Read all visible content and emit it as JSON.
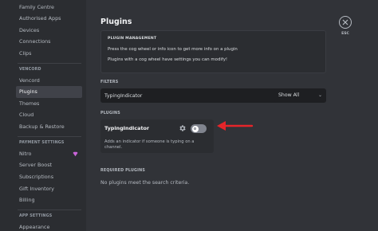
{
  "sidebar": {
    "items_top": [
      {
        "label": "Family Centre"
      },
      {
        "label": "Authorised Apps"
      },
      {
        "label": "Devices"
      },
      {
        "label": "Connections"
      },
      {
        "label": "Clips"
      }
    ],
    "vencord_header": "VENCORD",
    "vencord_items": [
      {
        "label": "Vencord"
      },
      {
        "label": "Plugins",
        "active": true
      },
      {
        "label": "Themes"
      },
      {
        "label": "Cloud"
      },
      {
        "label": "Backup & Restore"
      }
    ],
    "payment_header": "PAYMENT SETTINGS",
    "payment_items": [
      {
        "label": "Nitro"
      },
      {
        "label": "Server Boost"
      },
      {
        "label": "Subscriptions"
      },
      {
        "label": "Gift Inventory"
      },
      {
        "label": "Billing"
      }
    ],
    "app_header": "APP SETTINGS",
    "app_items": [
      {
        "label": "Appearance"
      }
    ],
    "nitro_icon": "nitro-badge-icon",
    "nitro_icon_color": "#c964d8"
  },
  "main": {
    "title": "Plugins",
    "info": {
      "title": "PLUGIN MANAGEMENT",
      "line1": "Press the cog wheel or info icon to get more info on a plugin",
      "line2": "Plugins with a cog wheel have settings you can modify!"
    },
    "filters": {
      "label": "FILTERS",
      "search_value": "TypingIndicator",
      "select_value": "Show All"
    },
    "plugins": {
      "label": "PLUGINS",
      "card": {
        "name": "TypingIndicator",
        "description": "Adds an indicator if someone is typing on a channel.",
        "enabled": false
      }
    },
    "required": {
      "label": "REQUIRED PLUGINS",
      "empty_text": "No plugins meet the search criteria."
    },
    "esc_label": "ESC"
  },
  "colors": {
    "sidebar_bg": "#2b2d31",
    "main_bg": "#313338",
    "input_bg": "#1e1f22",
    "arrow": "#e5252a",
    "toggle_off": "#80848e"
  }
}
